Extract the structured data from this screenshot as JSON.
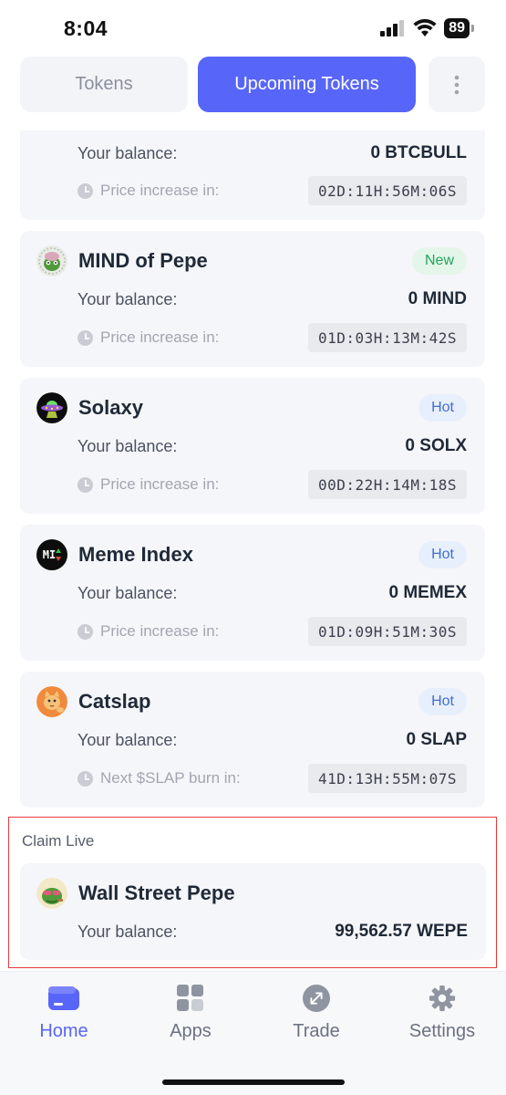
{
  "status_bar": {
    "time": "8:04",
    "battery": "89",
    "icons": [
      "signal-icon",
      "wifi-icon",
      "battery-icon"
    ]
  },
  "tabs": {
    "tokens": "Tokens",
    "upcoming": "Upcoming Tokens",
    "more_icon": "more-vertical-icon"
  },
  "colors": {
    "accent": "#5865f9",
    "new_badge": "#22a35a",
    "hot_badge": "#3f6fcf",
    "highlight_border": "#e23b3b"
  },
  "cards": [
    {
      "balance_label": "Your balance:",
      "balance": "0 BTCBULL",
      "timer_label": "Price increase in:",
      "countdown": "02D:11H:56M:06S"
    },
    {
      "name": "MIND of Pepe",
      "badge": "New",
      "balance_label": "Your balance:",
      "balance": "0 MIND",
      "timer_label": "Price increase in:",
      "countdown": "01D:03H:13M:42S",
      "icon": "pepe-brain-icon"
    },
    {
      "name": "Solaxy",
      "badge": "Hot",
      "balance_label": "Your balance:",
      "balance": "0 SOLX",
      "timer_label": "Price increase in:",
      "countdown": "00D:22H:14M:18S",
      "icon": "ufo-icon"
    },
    {
      "name": "Meme Index",
      "badge": "Hot",
      "balance_label": "Your balance:",
      "balance": "0 MEMEX",
      "timer_label": "Price increase in:",
      "countdown": "01D:09H:51M:30S",
      "icon": "mi-logo-icon",
      "icon_text": "MI"
    },
    {
      "name": "Catslap",
      "badge": "Hot",
      "balance_label": "Your balance:",
      "balance": "0 SLAP",
      "timer_label": "Next $SLAP burn in:",
      "countdown": "41D:13H:55M:07S",
      "icon": "cat-icon"
    }
  ],
  "claim_live": {
    "title": "Claim Live",
    "token": {
      "name": "Wall Street Pepe",
      "balance_label": "Your balance:",
      "balance": "99,562.57 WEPE",
      "icon": "wall-street-pepe-icon"
    }
  },
  "bottom_nav": [
    {
      "label": "Home",
      "icon": "wallet-icon",
      "active": true
    },
    {
      "label": "Apps",
      "icon": "apps-grid-icon",
      "active": false
    },
    {
      "label": "Trade",
      "icon": "trade-arrows-icon",
      "active": false
    },
    {
      "label": "Settings",
      "icon": "gear-icon",
      "active": false
    }
  ]
}
